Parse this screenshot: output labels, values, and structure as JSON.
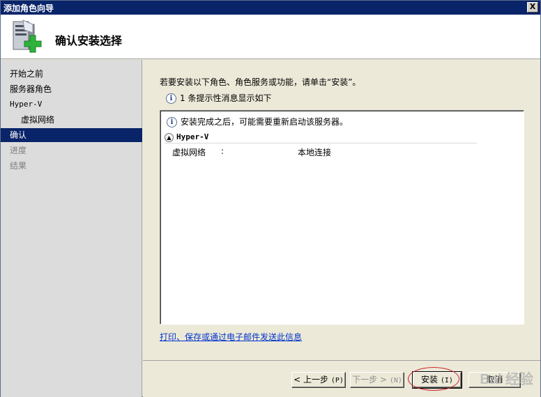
{
  "window": {
    "title": "添加角色向导",
    "close_label": "X"
  },
  "header": {
    "title": "确认安装选择",
    "icon": "server-add-icon"
  },
  "sidebar": {
    "items": [
      {
        "label": "开始之前",
        "state": "normal"
      },
      {
        "label": "服务器角色",
        "state": "normal"
      },
      {
        "label": "Hyper-V",
        "state": "normal"
      },
      {
        "label": "虚拟网络",
        "state": "normal"
      },
      {
        "label": "确认",
        "state": "active"
      },
      {
        "label": "进度",
        "state": "disabled"
      },
      {
        "label": "结果",
        "state": "disabled"
      }
    ]
  },
  "main": {
    "intro": "若要安装以下角色、角色服务或功能，请单击“安装”。",
    "info_summary": "1 条提示性消息显示如下",
    "notice": "安装完成之后，可能需要重新启动该服务器。",
    "section": {
      "title": "Hyper-V",
      "detail_key": "虚拟网络",
      "detail_sep": ":",
      "detail_value": "本地连接"
    },
    "print_link": "打印、保存或通过电子邮件发送此信息"
  },
  "buttons": {
    "prev": {
      "label": "< 上一步",
      "accel": "(P)"
    },
    "next": {
      "label": "下一步 >",
      "accel": "(N)"
    },
    "install": {
      "label": "安装",
      "accel": "(I)"
    },
    "cancel": {
      "label": "取消"
    }
  },
  "watermark": "Bai 经验"
}
